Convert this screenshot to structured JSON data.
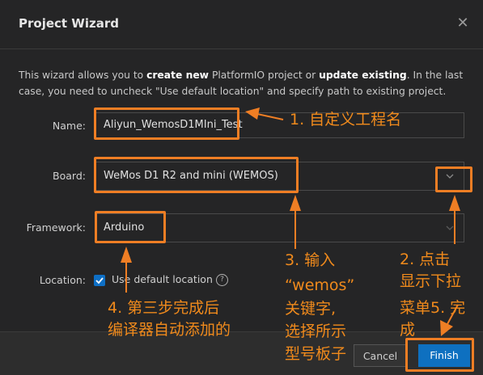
{
  "dialog": {
    "title": "Project Wizard",
    "intro_part1": "This wizard allows you to ",
    "intro_bold1": "create new",
    "intro_part2": " PlatformIO project or ",
    "intro_bold2": "update existing",
    "intro_part3": ". In the last case, you need to uncheck \"Use default location\" and specify path to existing project."
  },
  "form": {
    "name_label": "Name:",
    "name_value": "Aliyun_WemosD1MIni_Test",
    "board_label": "Board:",
    "board_value": "WeMos D1 R2 and mini (WEMOS)",
    "framework_label": "Framework:",
    "framework_value": "Arduino",
    "location_label": "Location:",
    "location_checkbox": "Use default location",
    "location_checked": true
  },
  "buttons": {
    "cancel": "Cancel",
    "finish": "Finish"
  },
  "annotations": {
    "a1": "1. 自定义工程名",
    "a2_line1": "2.  点击",
    "a2_line2": "显示下拉",
    "a2_line3": "菜单5. 完",
    "a2_line4": "成",
    "a3_line1": "3. 输入",
    "a3_line2": "“wemos”",
    "a3_line3": "关键字,",
    "a3_line4": "选择所示",
    "a3_line5": "型号板子",
    "a4_line1": "4. 第三步完成后",
    "a4_line2": "编译器自动添加的"
  },
  "colors": {
    "annotation": "#ef7e24",
    "accent": "#0e70c0",
    "background": "#252526"
  }
}
